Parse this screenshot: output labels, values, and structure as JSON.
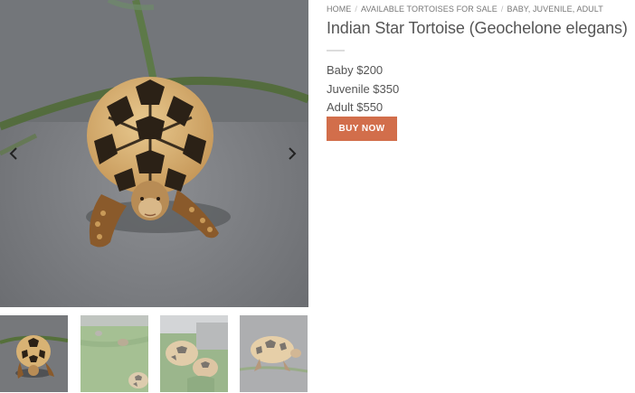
{
  "breadcrumb": {
    "items": [
      "HOME",
      "AVAILABLE TORTOISES FOR SALE",
      "BABY, JUVENILE, ADULT"
    ],
    "separator": "/"
  },
  "product": {
    "title": "Indian Star Tortoise (Geochelone elegans)",
    "prices": [
      "Baby $200",
      "Juvenile $350",
      "Adult $550"
    ],
    "buy_label": "BUY NOW"
  },
  "gallery": {
    "prev_icon": "chevron-left-icon",
    "next_icon": "chevron-right-icon",
    "thumbnail_count": 4,
    "active_thumbnail": 1
  },
  "colors": {
    "buy_button": "#d26e4b",
    "title": "#555555",
    "breadcrumb": "#777777"
  }
}
